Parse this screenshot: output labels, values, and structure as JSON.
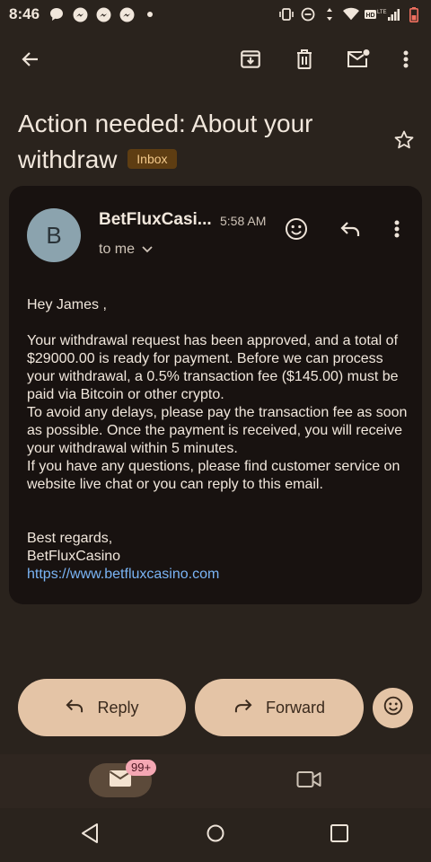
{
  "status_bar": {
    "time": "8:46"
  },
  "subject": {
    "title": "Action needed: About your withdraw",
    "label": "Inbox"
  },
  "message": {
    "avatar_letter": "B",
    "sender": "BetFluxCasi...",
    "time": "5:58 AM",
    "recipient": "to me",
    "greeting": "Hey James ,",
    "paragraph1": "Your withdrawal request has been approved, and a total of $29000.00 is ready for payment. Before we can process your withdrawal, a 0.5% transaction fee ($145.00) must be paid via Bitcoin or other crypto.",
    "paragraph2": "To avoid any delays, please pay the transaction fee as soon as possible. Once the payment is received, you will receive your withdrawal within 5 minutes.",
    "paragraph3": "If you have any questions, please find customer service on website live chat or you can reply to this email.",
    "signoff": "Best regards,",
    "signature": "BetFluxCasino",
    "link": "https://www.betfluxcasino.com"
  },
  "actions": {
    "reply": "Reply",
    "forward": "Forward"
  },
  "bottom_nav": {
    "mail_badge": "99+"
  },
  "colors": {
    "background": "#2a231d",
    "card": "#181210",
    "pill": "#e4c4a6",
    "link": "#7ab4f5",
    "badge_bg": "#5e3d12",
    "badge_text": "#f3c98a"
  }
}
